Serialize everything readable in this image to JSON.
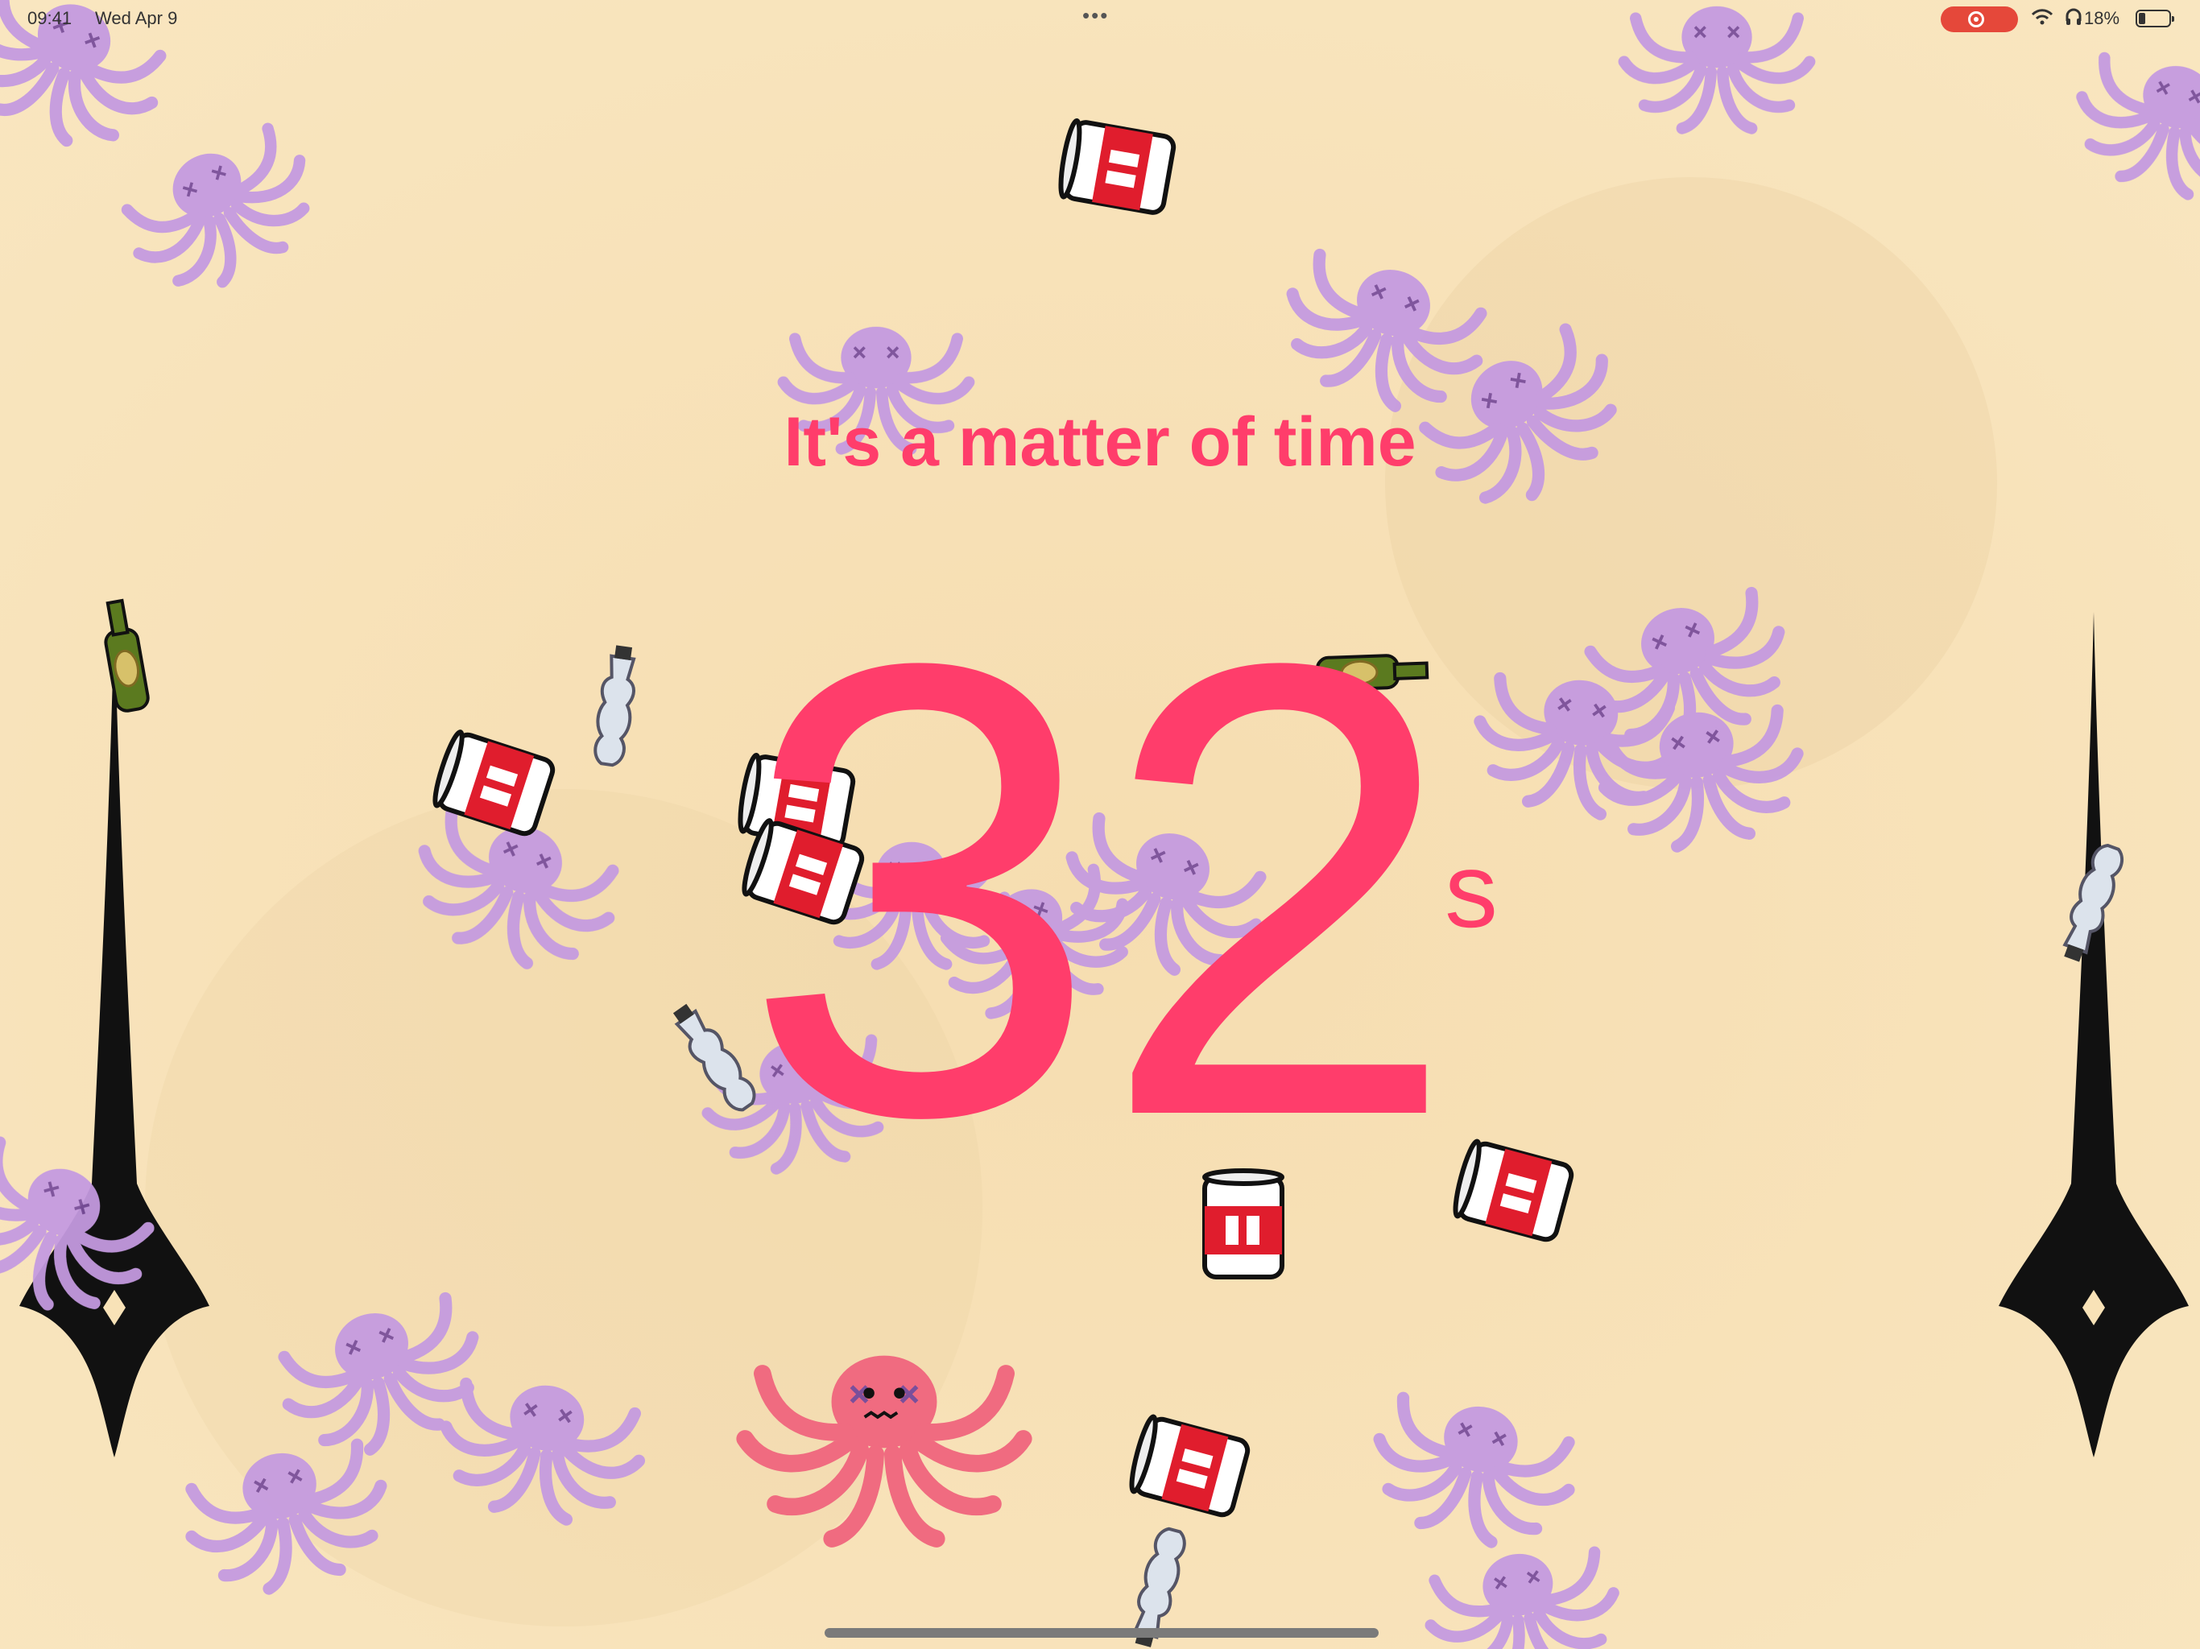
{
  "status_bar": {
    "time": "09:41",
    "date": "Wed Apr 9",
    "battery": "18%",
    "icons": [
      "multitask-dots-icon",
      "screen-recording-icon",
      "wifi-icon",
      "headphones-icon",
      "battery-icon"
    ]
  },
  "game": {
    "title": "It's a matter of time",
    "countdown_value": "32",
    "countdown_unit": "s"
  },
  "colors": {
    "background": "#f8e2b7",
    "accent": "#ff3d6b",
    "enemy_octopus": "#c49ae0",
    "player_octopus": "#f06b80",
    "hand": "#111111"
  },
  "sprites": [
    "player-octopus-icon",
    "enemy-octopus-icon",
    "can-icon",
    "bottle-icon",
    "plastic-bottle-icon",
    "clock-hand-icon"
  ]
}
